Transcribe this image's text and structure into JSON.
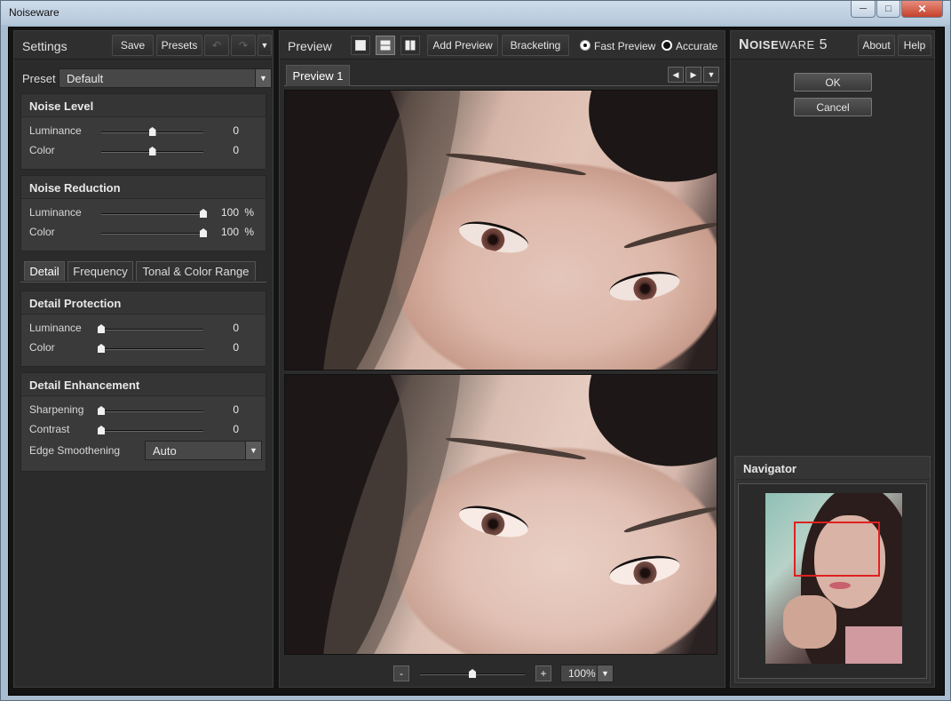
{
  "window": {
    "title": "Noiseware",
    "controls": [
      "minimize",
      "maximize",
      "close"
    ]
  },
  "settings": {
    "title": "Settings",
    "save_label": "Save",
    "presets_label": "Presets",
    "preset_label": "Preset",
    "preset_value": "Default",
    "noise_level": {
      "title": "Noise Level",
      "rows": [
        {
          "label": "Luminance",
          "value": "0",
          "position": 0.5
        },
        {
          "label": "Color",
          "value": "0",
          "position": 0.5
        }
      ]
    },
    "noise_reduction": {
      "title": "Noise Reduction",
      "rows": [
        {
          "label": "Luminance",
          "value": "100",
          "unit": "%",
          "position": 1.0
        },
        {
          "label": "Color",
          "value": "100",
          "unit": "%",
          "position": 1.0
        }
      ]
    },
    "tabs": [
      "Detail",
      "Frequency",
      "Tonal & Color Range"
    ],
    "detail_protection": {
      "title": "Detail Protection",
      "rows": [
        {
          "label": "Luminance",
          "value": "0",
          "position": 0.0
        },
        {
          "label": "Color",
          "value": "0",
          "position": 0.0
        }
      ]
    },
    "detail_enhancement": {
      "title": "Detail Enhancement",
      "rows": [
        {
          "label": "Sharpening",
          "value": "0",
          "position": 0.0
        },
        {
          "label": "Contrast",
          "value": "0",
          "position": 0.0
        }
      ],
      "edge_label": "Edge Smoothening",
      "edge_value": "Auto"
    }
  },
  "preview": {
    "title": "Preview",
    "add_preview_label": "Add Preview",
    "bracketing_label": "Bracketing",
    "fast_preview_label": "Fast Preview",
    "accurate_label": "Accurate",
    "tab_label": "Preview 1",
    "zoom_minus": "-",
    "zoom_plus": "+",
    "zoom_value": "100%",
    "zoom_position": 0.5
  },
  "right": {
    "logo_big": "N",
    "logo_small": "OISE",
    "logo_big2": "",
    "logo_small2": "WARE",
    "logo_num": "5",
    "about_label": "About",
    "help_label": "Help",
    "ok_label": "OK",
    "cancel_label": "Cancel",
    "navigator_title": "Navigator"
  },
  "colors": {
    "accent_selection": "#e02020",
    "panel_bg": "#2b2b2b"
  }
}
